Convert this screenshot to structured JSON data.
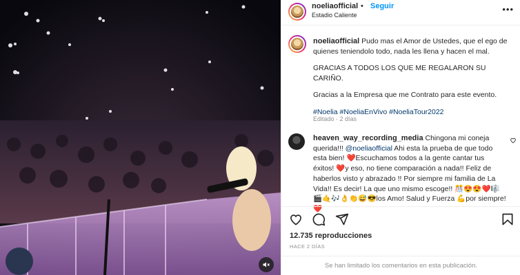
{
  "header": {
    "username": "noeliaofficial",
    "separator": "•",
    "follow_label": "Seguir",
    "location": "Estadio Caliente",
    "more_glyph": "•••"
  },
  "caption": {
    "username": "noeliaofficial",
    "line1": "Pudo mas el Amor de Ustedes, que el ego de quienes teniendolo todo, nada les llena y hacen el mal.",
    "line2": "GRACIAS A TODOS LOS QUE ME REGALARON SU CARIÑO.",
    "line3": "Gracias a la Empresa que me Contrato para este evento.",
    "hashtags": "#Noelia #NoeliaEnVivo #NoeliaTour2022",
    "meta": "Editado · 2 días"
  },
  "comment": {
    "username": "heaven_way_recording_media",
    "text_a": "Chingona mi coneja querida!!! ",
    "mention": "@noeliaofficial",
    "text_b": " Ahi esta la prueba de que todo esta bien! ❤️Escuchamos todos a la gente cantar tus éxitos! ❤️y eso, no tiene comparación a nada!! Feliz de haberlos visto y abrazado !! Por siempre mi familia de La Vida!! Es decir! La que uno mismo escoge!! 🎊😍😍❤️🎼🎬🤙🎶👌👏😅😎los Amo! Salud y Fuerza 💪por siempre! ❤️"
  },
  "stats": {
    "likes": "12.735 reproducciones",
    "when": "HACE 2 DÍAS"
  },
  "footer": {
    "limited": "Se han limitado los comentarios en esta publicación."
  },
  "icons": {
    "mute": "speaker-muted-icon",
    "like": "heart-icon",
    "comment": "comment-icon",
    "share": "send-icon",
    "save": "bookmark-icon"
  },
  "colors": {
    "accent": "#0095f6",
    "link": "#00376b",
    "muted": "#8e8e8e",
    "heart": "#ed4956"
  }
}
